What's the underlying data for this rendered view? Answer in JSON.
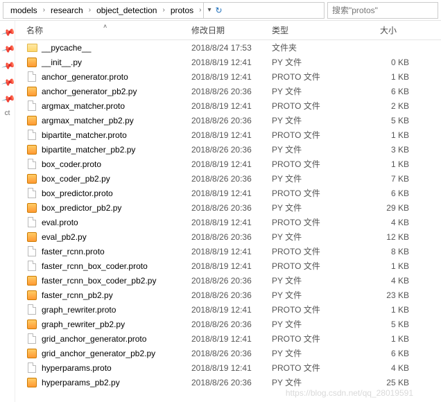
{
  "breadcrumb": [
    "models",
    "research",
    "object_detection",
    "protos"
  ],
  "search_placeholder": "搜索\"protos\"",
  "columns": {
    "name": "名称",
    "date": "修改日期",
    "type": "类型",
    "size": "大小"
  },
  "left_label": "ct",
  "files": [
    {
      "icon": "folder",
      "name": "__pycache__",
      "date": "2018/8/24 17:53",
      "type": "文件夹",
      "size": ""
    },
    {
      "icon": "py",
      "name": "__init__.py",
      "date": "2018/8/19 12:41",
      "type": "PY 文件",
      "size": "0 KB"
    },
    {
      "icon": "file",
      "name": "anchor_generator.proto",
      "date": "2018/8/19 12:41",
      "type": "PROTO 文件",
      "size": "1 KB"
    },
    {
      "icon": "py",
      "name": "anchor_generator_pb2.py",
      "date": "2018/8/26 20:36",
      "type": "PY 文件",
      "size": "6 KB"
    },
    {
      "icon": "file",
      "name": "argmax_matcher.proto",
      "date": "2018/8/19 12:41",
      "type": "PROTO 文件",
      "size": "2 KB"
    },
    {
      "icon": "py",
      "name": "argmax_matcher_pb2.py",
      "date": "2018/8/26 20:36",
      "type": "PY 文件",
      "size": "5 KB"
    },
    {
      "icon": "file",
      "name": "bipartite_matcher.proto",
      "date": "2018/8/19 12:41",
      "type": "PROTO 文件",
      "size": "1 KB"
    },
    {
      "icon": "py",
      "name": "bipartite_matcher_pb2.py",
      "date": "2018/8/26 20:36",
      "type": "PY 文件",
      "size": "3 KB"
    },
    {
      "icon": "file",
      "name": "box_coder.proto",
      "date": "2018/8/19 12:41",
      "type": "PROTO 文件",
      "size": "1 KB"
    },
    {
      "icon": "py",
      "name": "box_coder_pb2.py",
      "date": "2018/8/26 20:36",
      "type": "PY 文件",
      "size": "7 KB"
    },
    {
      "icon": "file",
      "name": "box_predictor.proto",
      "date": "2018/8/19 12:41",
      "type": "PROTO 文件",
      "size": "6 KB"
    },
    {
      "icon": "py",
      "name": "box_predictor_pb2.py",
      "date": "2018/8/26 20:36",
      "type": "PY 文件",
      "size": "29 KB"
    },
    {
      "icon": "file",
      "name": "eval.proto",
      "date": "2018/8/19 12:41",
      "type": "PROTO 文件",
      "size": "4 KB"
    },
    {
      "icon": "py",
      "name": "eval_pb2.py",
      "date": "2018/8/26 20:36",
      "type": "PY 文件",
      "size": "12 KB"
    },
    {
      "icon": "file",
      "name": "faster_rcnn.proto",
      "date": "2018/8/19 12:41",
      "type": "PROTO 文件",
      "size": "8 KB"
    },
    {
      "icon": "file",
      "name": "faster_rcnn_box_coder.proto",
      "date": "2018/8/19 12:41",
      "type": "PROTO 文件",
      "size": "1 KB"
    },
    {
      "icon": "py",
      "name": "faster_rcnn_box_coder_pb2.py",
      "date": "2018/8/26 20:36",
      "type": "PY 文件",
      "size": "4 KB"
    },
    {
      "icon": "py",
      "name": "faster_rcnn_pb2.py",
      "date": "2018/8/26 20:36",
      "type": "PY 文件",
      "size": "23 KB"
    },
    {
      "icon": "file",
      "name": "graph_rewriter.proto",
      "date": "2018/8/19 12:41",
      "type": "PROTO 文件",
      "size": "1 KB"
    },
    {
      "icon": "py",
      "name": "graph_rewriter_pb2.py",
      "date": "2018/8/26 20:36",
      "type": "PY 文件",
      "size": "5 KB"
    },
    {
      "icon": "file",
      "name": "grid_anchor_generator.proto",
      "date": "2018/8/19 12:41",
      "type": "PROTO 文件",
      "size": "1 KB"
    },
    {
      "icon": "py",
      "name": "grid_anchor_generator_pb2.py",
      "date": "2018/8/26 20:36",
      "type": "PY 文件",
      "size": "6 KB"
    },
    {
      "icon": "file",
      "name": "hyperparams.proto",
      "date": "2018/8/19 12:41",
      "type": "PROTO 文件",
      "size": "4 KB"
    },
    {
      "icon": "py",
      "name": "hyperparams_pb2.py",
      "date": "2018/8/26 20:36",
      "type": "PY 文件",
      "size": "25 KB"
    }
  ],
  "watermark": "https://blog.csdn.net/qq_28019591"
}
